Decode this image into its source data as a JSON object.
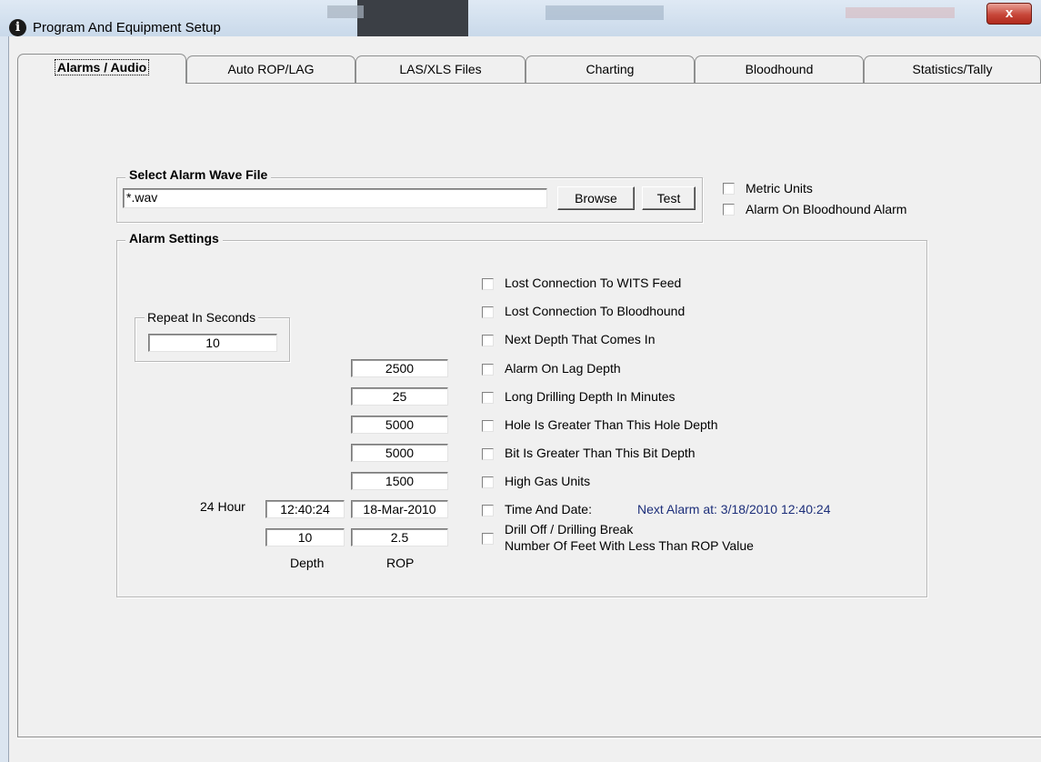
{
  "window": {
    "title": "Program And Equipment Setup",
    "close_glyph": "x",
    "accent_color": "#c7473a"
  },
  "tabs": [
    {
      "label": "Alarms / Audio",
      "active": true
    },
    {
      "label": "Auto ROP/LAG"
    },
    {
      "label": "LAS/XLS Files"
    },
    {
      "label": "Charting"
    },
    {
      "label": "Bloodhound"
    },
    {
      "label": "Statistics/Tally"
    }
  ],
  "wave_file": {
    "group_label": "Select Alarm Wave File",
    "path_value": "*.wav",
    "browse_label": "Browse",
    "test_label": "Test"
  },
  "options": {
    "metric_units": {
      "label": "Metric Units",
      "checked": false
    },
    "alarm_on_bloodhound": {
      "label": "Alarm On Bloodhound Alarm",
      "checked": false
    }
  },
  "alarm_settings": {
    "group_label": "Alarm Settings",
    "repeat_label": "Repeat In Seconds",
    "repeat_value": "10",
    "time_label": "24 Hour",
    "depth_label": "Depth",
    "rop_label": "ROP",
    "next_alarm_text": "Next Alarm at: 3/18/2010 12:40:24",
    "values": {
      "lag_depth": "2500",
      "long_drilling_minutes": "25",
      "hole_depth": "5000",
      "bit_depth": "5000",
      "high_gas_units": "1500",
      "time": "12:40:24",
      "date": "18-Mar-2010",
      "drill_off_depth": "10",
      "drill_off_rop": "2.5"
    },
    "checks": {
      "lost_wits": {
        "label": "Lost Connection To WITS Feed",
        "checked": false
      },
      "lost_bloodhound": {
        "label": "Lost Connection To Bloodhound",
        "checked": false
      },
      "next_depth": {
        "label": "Next Depth That Comes In",
        "checked": false
      },
      "lag_depth": {
        "label": "Alarm On Lag Depth",
        "checked": false
      },
      "long_drilling": {
        "label": "Long Drilling Depth In Minutes",
        "checked": false
      },
      "hole_depth": {
        "label": "Hole Is Greater Than This Hole Depth",
        "checked": false
      },
      "bit_depth": {
        "label": "Bit Is Greater Than This Bit Depth",
        "checked": false
      },
      "high_gas": {
        "label": "High Gas Units",
        "checked": false
      },
      "time_date": {
        "label": "Time And Date:",
        "checked": false
      },
      "drill_off": {
        "label": "Drill Off / Drilling Break",
        "sublabel": "Number Of Feet With Less Than ROP Value",
        "checked": false
      }
    }
  }
}
